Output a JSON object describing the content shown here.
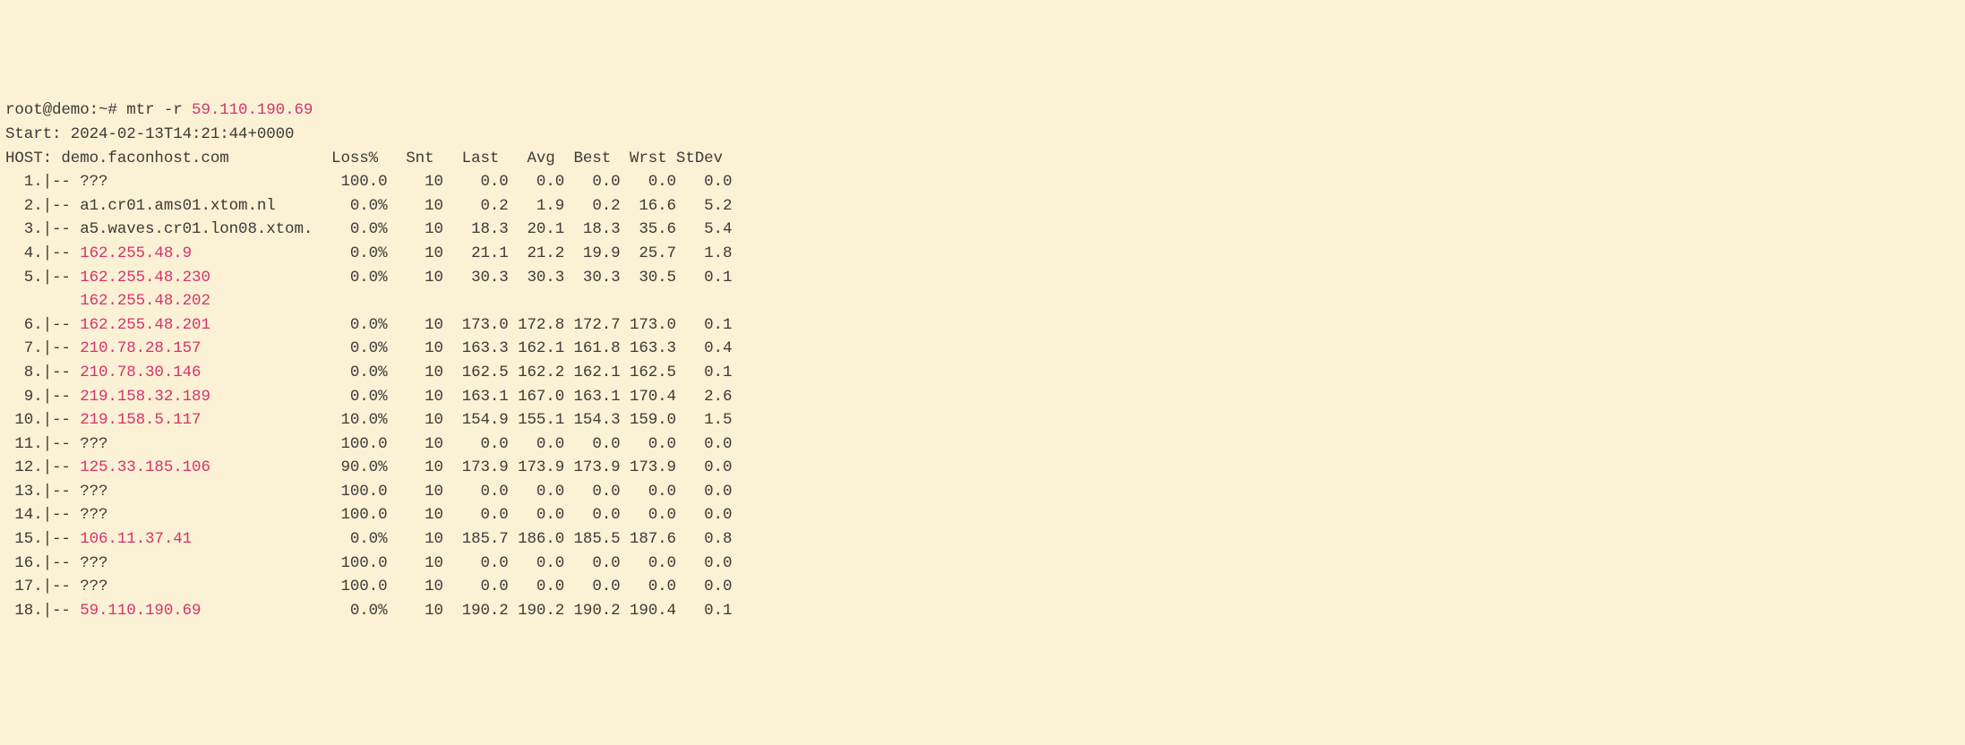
{
  "command": {
    "prompt": "root@demo:~# ",
    "cmd": "mtr -r ",
    "target_ip": "59.110.190.69"
  },
  "start_line": "Start: 2024-02-13T14:21:44+0000",
  "host_label": "HOST: demo.faconhost.com",
  "headers": {
    "loss": "Loss%",
    "snt": "Snt",
    "last": "Last",
    "avg": "Avg",
    "best": "Best",
    "wrst": "Wrst",
    "stdev": "StDev"
  },
  "hops": [
    {
      "num": " 1",
      "host": "???",
      "is_ip": false,
      "loss": "100.0",
      "snt": "10",
      "last": "0.0",
      "avg": "0.0",
      "best": "0.0",
      "wrst": "0.0",
      "stdev": "0.0"
    },
    {
      "num": " 2",
      "host": "a1.cr01.ams01.xtom.nl",
      "is_ip": false,
      "loss": "0.0%",
      "snt": "10",
      "last": "0.2",
      "avg": "1.9",
      "best": "0.2",
      "wrst": "16.6",
      "stdev": "5.2"
    },
    {
      "num": " 3",
      "host": "a5.waves.cr01.lon08.xtom.",
      "is_ip": false,
      "loss": "0.0%",
      "snt": "10",
      "last": "18.3",
      "avg": "20.1",
      "best": "18.3",
      "wrst": "35.6",
      "stdev": "5.4"
    },
    {
      "num": " 4",
      "host": "162.255.48.9",
      "is_ip": true,
      "loss": "0.0%",
      "snt": "10",
      "last": "21.1",
      "avg": "21.2",
      "best": "19.9",
      "wrst": "25.7",
      "stdev": "1.8"
    },
    {
      "num": " 5",
      "host": "162.255.48.230",
      "is_ip": true,
      "loss": "0.0%",
      "snt": "10",
      "last": "30.3",
      "avg": "30.3",
      "best": "30.3",
      "wrst": "30.5",
      "stdev": "0.1",
      "extra_host": "162.255.48.202"
    },
    {
      "num": " 6",
      "host": "162.255.48.201",
      "is_ip": true,
      "loss": "0.0%",
      "snt": "10",
      "last": "173.0",
      "avg": "172.8",
      "best": "172.7",
      "wrst": "173.0",
      "stdev": "0.1"
    },
    {
      "num": " 7",
      "host": "210.78.28.157",
      "is_ip": true,
      "loss": "0.0%",
      "snt": "10",
      "last": "163.3",
      "avg": "162.1",
      "best": "161.8",
      "wrst": "163.3",
      "stdev": "0.4"
    },
    {
      "num": " 8",
      "host": "210.78.30.146",
      "is_ip": true,
      "loss": "0.0%",
      "snt": "10",
      "last": "162.5",
      "avg": "162.2",
      "best": "162.1",
      "wrst": "162.5",
      "stdev": "0.1"
    },
    {
      "num": " 9",
      "host": "219.158.32.189",
      "is_ip": true,
      "loss": "0.0%",
      "snt": "10",
      "last": "163.1",
      "avg": "167.0",
      "best": "163.1",
      "wrst": "170.4",
      "stdev": "2.6"
    },
    {
      "num": "10",
      "host": "219.158.5.117",
      "is_ip": true,
      "loss": "10.0%",
      "snt": "10",
      "last": "154.9",
      "avg": "155.1",
      "best": "154.3",
      "wrst": "159.0",
      "stdev": "1.5"
    },
    {
      "num": "11",
      "host": "???",
      "is_ip": false,
      "loss": "100.0",
      "snt": "10",
      "last": "0.0",
      "avg": "0.0",
      "best": "0.0",
      "wrst": "0.0",
      "stdev": "0.0"
    },
    {
      "num": "12",
      "host": "125.33.185.106",
      "is_ip": true,
      "loss": "90.0%",
      "snt": "10",
      "last": "173.9",
      "avg": "173.9",
      "best": "173.9",
      "wrst": "173.9",
      "stdev": "0.0"
    },
    {
      "num": "13",
      "host": "???",
      "is_ip": false,
      "loss": "100.0",
      "snt": "10",
      "last": "0.0",
      "avg": "0.0",
      "best": "0.0",
      "wrst": "0.0",
      "stdev": "0.0"
    },
    {
      "num": "14",
      "host": "???",
      "is_ip": false,
      "loss": "100.0",
      "snt": "10",
      "last": "0.0",
      "avg": "0.0",
      "best": "0.0",
      "wrst": "0.0",
      "stdev": "0.0"
    },
    {
      "num": "15",
      "host": "106.11.37.41",
      "is_ip": true,
      "loss": "0.0%",
      "snt": "10",
      "last": "185.7",
      "avg": "186.0",
      "best": "185.5",
      "wrst": "187.6",
      "stdev": "0.8"
    },
    {
      "num": "16",
      "host": "???",
      "is_ip": false,
      "loss": "100.0",
      "snt": "10",
      "last": "0.0",
      "avg": "0.0",
      "best": "0.0",
      "wrst": "0.0",
      "stdev": "0.0"
    },
    {
      "num": "17",
      "host": "???",
      "is_ip": false,
      "loss": "100.0",
      "snt": "10",
      "last": "0.0",
      "avg": "0.0",
      "best": "0.0",
      "wrst": "0.0",
      "stdev": "0.0"
    },
    {
      "num": "18",
      "host": "59.110.190.69",
      "is_ip": true,
      "loss": "0.0%",
      "snt": "10",
      "last": "190.2",
      "avg": "190.2",
      "best": "190.2",
      "wrst": "190.4",
      "stdev": "0.1"
    }
  ]
}
